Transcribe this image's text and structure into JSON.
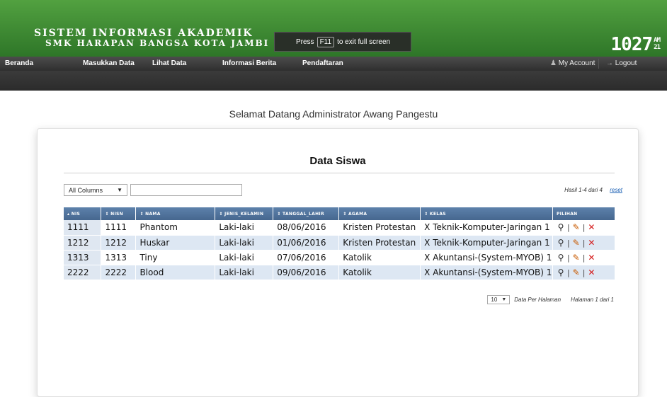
{
  "header": {
    "title_line1": "SISTEM INFORMASI AKADEMIK",
    "title_line2": "SMK HARAPAN BANGSA KOTA JAMBI",
    "clock_time": "1027",
    "clock_ampm": "AM",
    "clock_seconds": "21"
  },
  "fullscreen_popup": {
    "press": "Press",
    "key": "F11",
    "message": "to exit full screen"
  },
  "nav": {
    "items": [
      {
        "label": "Beranda"
      },
      {
        "label": "Masukkan Data"
      },
      {
        "label": "Lihat Data"
      },
      {
        "label": "Informasi Berita"
      },
      {
        "label": "Pendaftaran"
      }
    ],
    "my_account": "My Account",
    "logout": "Logout",
    "my_account_icon": "user-icon",
    "logout_icon": "arrow-right-icon"
  },
  "welcome": "Selamat Datang Administrator Awang Pangestu",
  "card": {
    "title": "Data Siswa",
    "filter_select": "All Columns",
    "filter_value": "",
    "results": "Hasil 1-4 dari 4",
    "reset": "reset"
  },
  "table": {
    "columns": [
      "▴ NIS",
      "⇕ NISN",
      "⇕ NAMA",
      "⇕ JENIS_KELAMIN",
      "⇕ TANGGAL_LAHIR",
      "⇕ AGAMA",
      "⇕ KELAS",
      "PILIHAN"
    ],
    "rows": [
      {
        "nis": "1111",
        "nisn": "1111",
        "nama": "Phantom",
        "jk": "Laki-laki",
        "tgl": "08/06/2016",
        "agama": "Kristen Protestan",
        "kelas": "X Teknik-Komputer-Jaringan 1"
      },
      {
        "nis": "1212",
        "nisn": "1212",
        "nama": "Huskar",
        "jk": "Laki-laki",
        "tgl": "01/06/2016",
        "agama": "Kristen Protestan",
        "kelas": "X Teknik-Komputer-Jaringan 1"
      },
      {
        "nis": "1313",
        "nisn": "1313",
        "nama": "Tiny",
        "jk": "Laki-laki",
        "tgl": "07/06/2016",
        "agama": "Katolik",
        "kelas": "X Akuntansi-(System-MYOB) 1"
      },
      {
        "nis": "2222",
        "nisn": "2222",
        "nama": "Blood",
        "jk": "Laki-laki",
        "tgl": "09/06/2016",
        "agama": "Katolik",
        "kelas": "X Akuntansi-(System-MYOB) 1"
      }
    ],
    "action_icons": [
      "magnifier-icon",
      "pencil-icon",
      "delete-x-icon"
    ],
    "action_separator": "|"
  },
  "pager": {
    "per_page": "10",
    "per_page_label": "Data Per Halaman",
    "page_info": "Halaman 1 dari 1"
  },
  "colors": {
    "header_green": "#3f8d35",
    "nav_dark": "#3a3a3a",
    "table_header": "#52739b",
    "row_alt": "#dde7f3",
    "delete_red": "#d41b1b",
    "link_blue": "#1a5fb4"
  }
}
